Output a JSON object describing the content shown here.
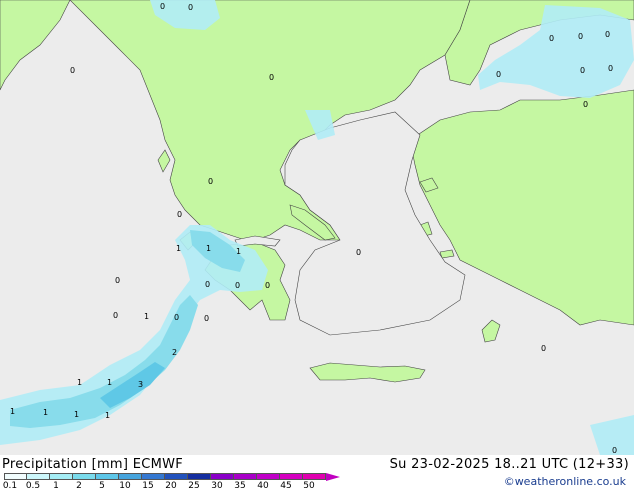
{
  "caption": {
    "variable": "Precipitation [mm]",
    "model": "ECMWF"
  },
  "validity": "Su 23-02-2025 18..21 UTC (12+33)",
  "credit": "©weatheronline.co.uk",
  "legend": {
    "ticks": [
      "0.1",
      "0.5",
      "1",
      "2",
      "5",
      "10",
      "15",
      "20",
      "25",
      "30",
      "35",
      "40",
      "45",
      "50"
    ],
    "colors": [
      "#f2fdfe",
      "#cdf7fb",
      "#a5edf5",
      "#7adbec",
      "#5dc6e8",
      "#46a4dd",
      "#3478d1",
      "#2252bd",
      "#152ea0",
      "#8a00c8",
      "#a800c8",
      "#c000c8",
      "#d400c0",
      "#e000b0"
    ]
  },
  "colors": {
    "land": "#c5f7a2",
    "sea": "#ececec",
    "rain_light": "#b0ecf6",
    "rain_mid": "#88dceb",
    "rain_heavy": "#5fc8e6"
  },
  "map_values": [
    "0",
    "0",
    "0",
    "0",
    "0",
    "0",
    "0",
    "0",
    "0",
    "0",
    "0",
    "0",
    "0",
    "1",
    "1",
    "1",
    "0",
    "0",
    "0",
    "0",
    "0",
    "1",
    "0",
    "0",
    "2",
    "1",
    "1",
    "3",
    "1",
    "1",
    "1",
    "1",
    "0",
    "0",
    "0"
  ]
}
